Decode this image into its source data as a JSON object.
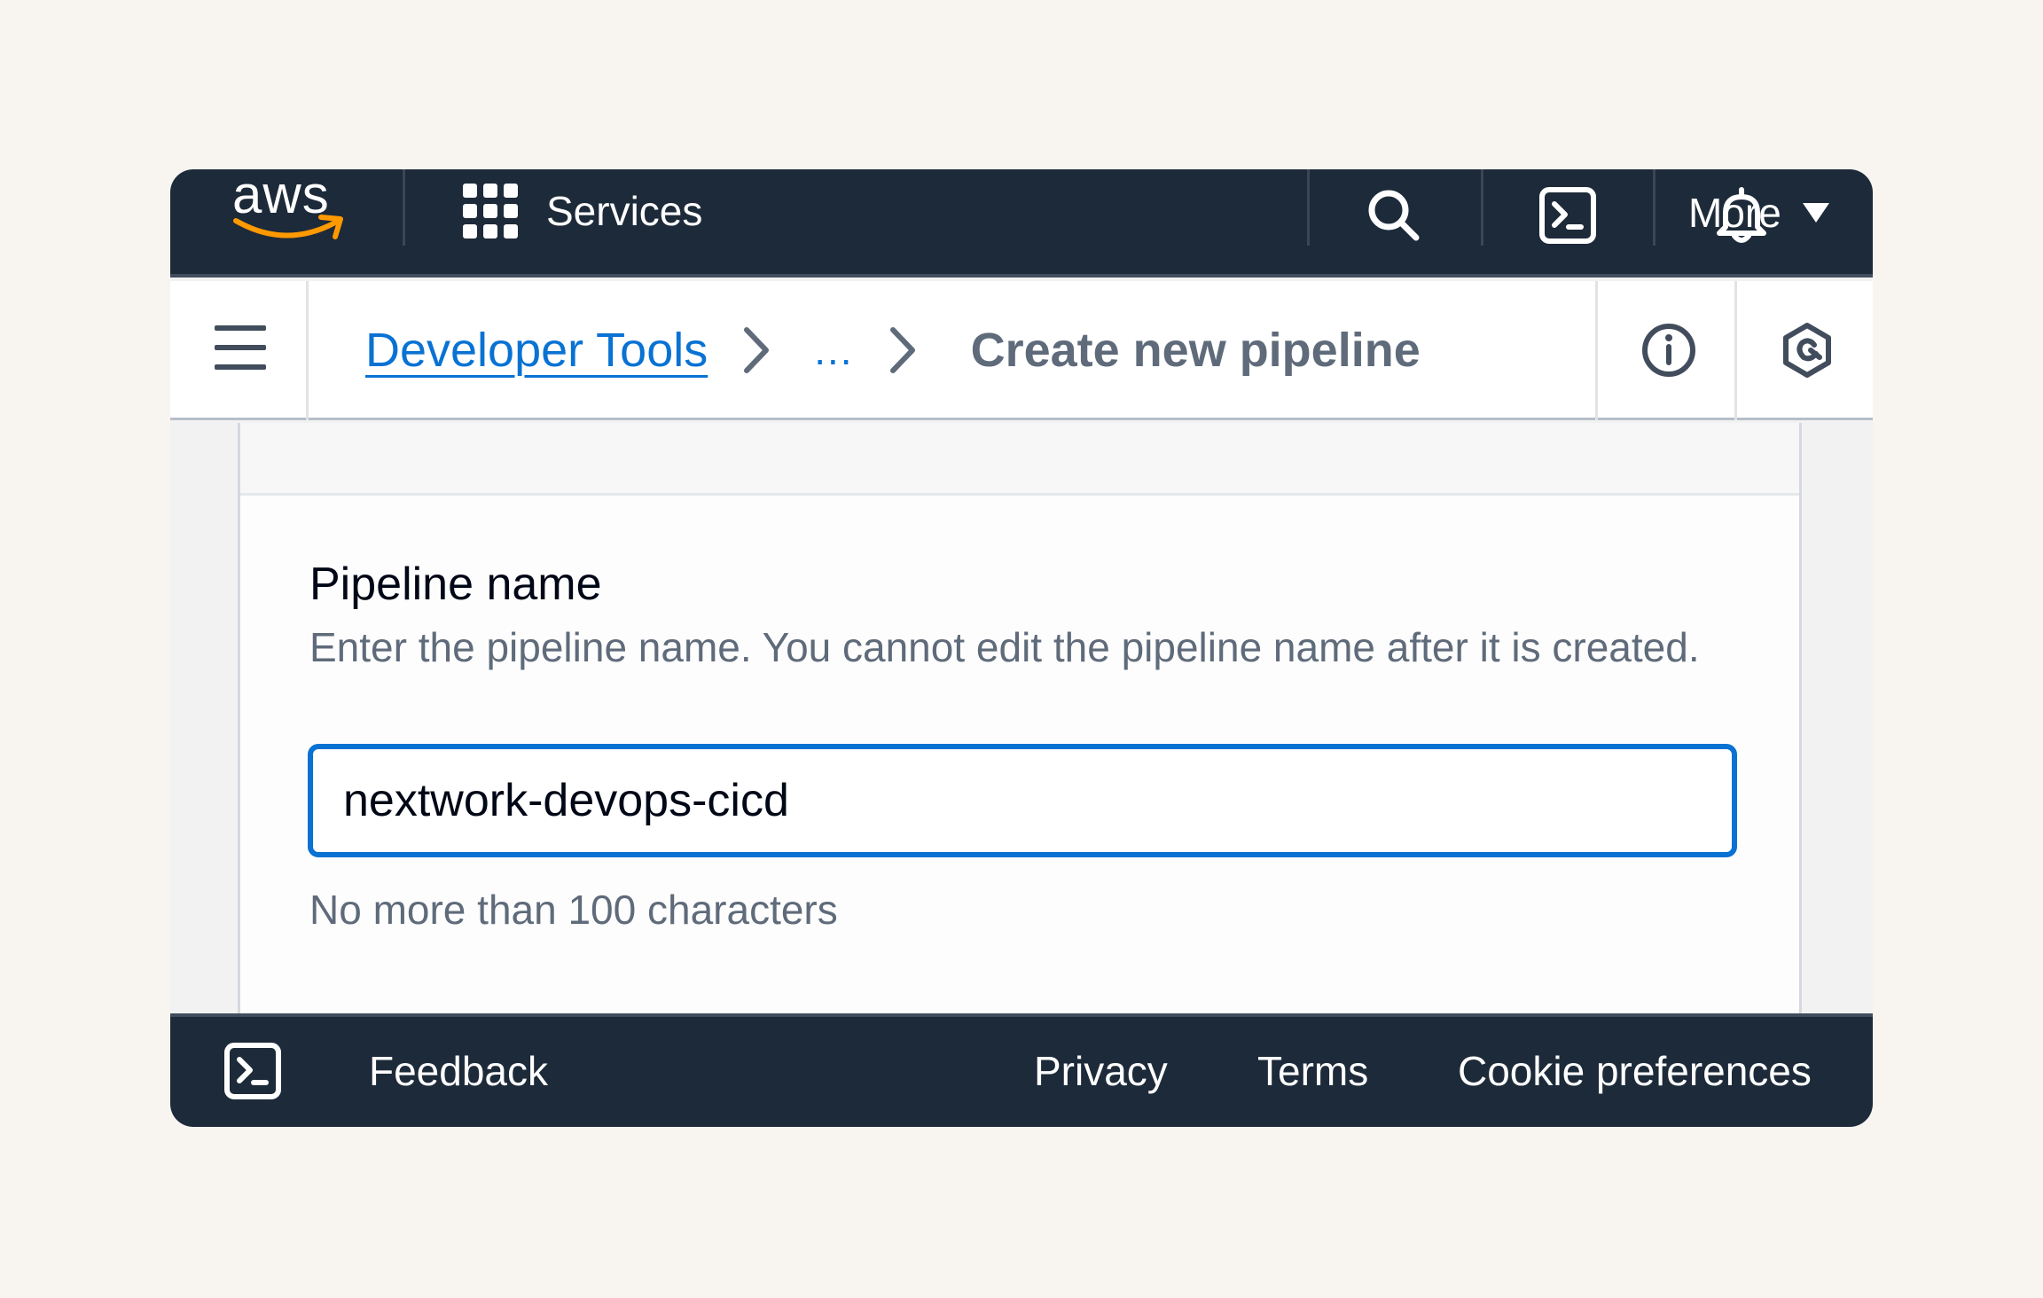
{
  "topnav": {
    "logo_text": "aws",
    "services_label": "Services",
    "more_label": "More",
    "icons": [
      "grid-icon",
      "search-icon",
      "cloudshell-icon",
      "bell-icon",
      "caret-down-icon"
    ]
  },
  "breadcrumb": {
    "root_label": "Developer Tools",
    "ellipsis": "...",
    "current_label": "Create new pipeline",
    "icons": [
      "menu-icon",
      "chevron-right-icon",
      "info-icon",
      "settings-hex-icon"
    ]
  },
  "form": {
    "label": "Pipeline name",
    "description": "Enter the pipeline name. You cannot edit the pipeline name after it is created.",
    "input_value": "nextwork-devops-cicd",
    "constraint": "No more than 100 characters"
  },
  "footer": {
    "feedback_label": "Feedback",
    "privacy_label": "Privacy",
    "terms_label": "Terms",
    "cookie_label": "Cookie preferences"
  },
  "colors": {
    "nav_bg": "#1d2a39",
    "link": "#0972d3",
    "text_secondary": "#5f6b7a",
    "accent_orange": "#ff9900",
    "page_bg": "#f8f5f1"
  }
}
